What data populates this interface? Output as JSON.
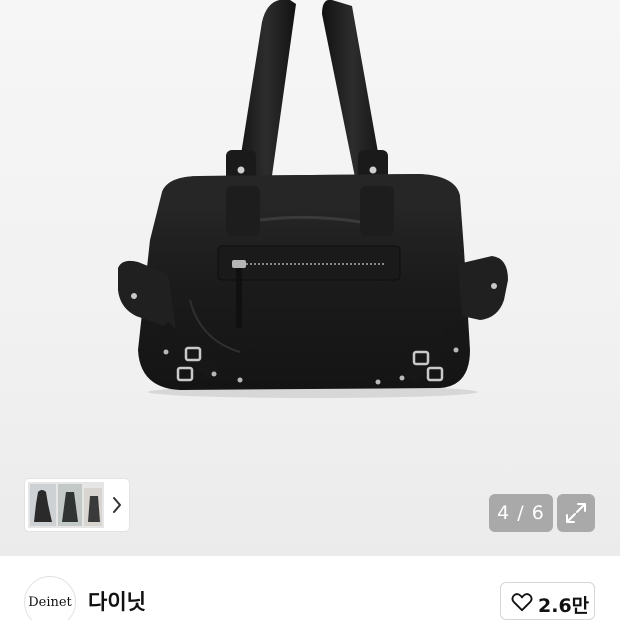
{
  "gallery": {
    "counter_text": "4 / 6",
    "current_index": 4,
    "total": 6,
    "expand_icon": "expand-arrows-icon",
    "thumb_next_icon": "chevron-right-icon"
  },
  "brand": {
    "logo_text": "Deinet",
    "name": "다이닛"
  },
  "like": {
    "icon": "heart-outline-icon",
    "count": "2.6만"
  },
  "colors": {
    "overlay": "#969696",
    "bag": "#1c1c1c",
    "text": "#111111"
  }
}
